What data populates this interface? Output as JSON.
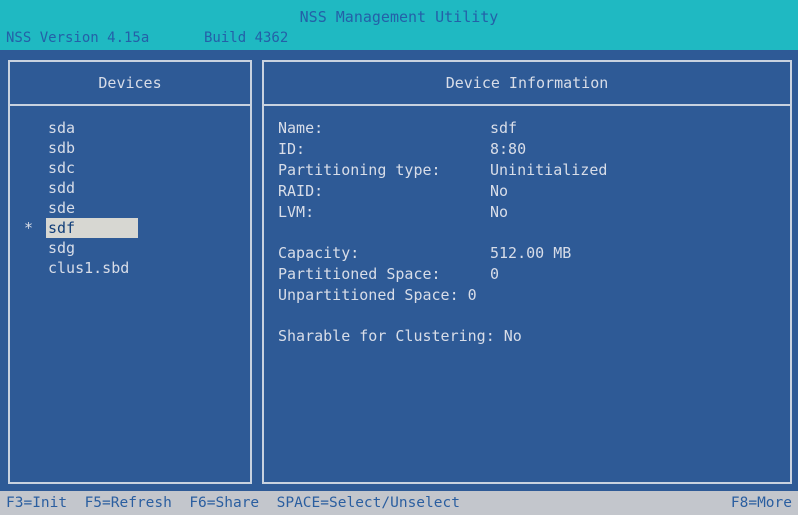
{
  "header": {
    "title": "NSS Management Utility",
    "version": "NSS Version 4.15a",
    "build": "Build 4362"
  },
  "devices_panel": {
    "title": "Devices",
    "items": [
      {
        "label": "sda",
        "marker": "",
        "selected": false
      },
      {
        "label": "sdb",
        "marker": "",
        "selected": false
      },
      {
        "label": "sdc",
        "marker": "",
        "selected": false
      },
      {
        "label": "sdd",
        "marker": "",
        "selected": false
      },
      {
        "label": "sde",
        "marker": "",
        "selected": false
      },
      {
        "label": "sdf",
        "marker": "*",
        "selected": true
      },
      {
        "label": "sdg",
        "marker": "",
        "selected": false
      },
      {
        "label": "clus1.sbd",
        "marker": "",
        "selected": false
      }
    ]
  },
  "info_panel": {
    "title": "Device Information",
    "name": {
      "label": "Name:",
      "value": "sdf"
    },
    "id": {
      "label": "ID:",
      "value": "8:80"
    },
    "partitioning": {
      "label": "Partitioning type:",
      "value": "Uninitialized"
    },
    "raid": {
      "label": "RAID:",
      "value": "No"
    },
    "lvm": {
      "label": "LVM:",
      "value": "No"
    },
    "capacity": {
      "label": "Capacity:",
      "value": "512.00 MB"
    },
    "partitioned": {
      "label": "Partitioned Space:",
      "value": "0"
    },
    "unpartitioned": {
      "label": "Unpartitioned Space: 0"
    },
    "sharable": {
      "label": "Sharable for Clustering: No"
    }
  },
  "footer": {
    "keys": "F3=Init  F5=Refresh  F6=Share  SPACE=Select/Unselect",
    "more": "F8=More"
  }
}
